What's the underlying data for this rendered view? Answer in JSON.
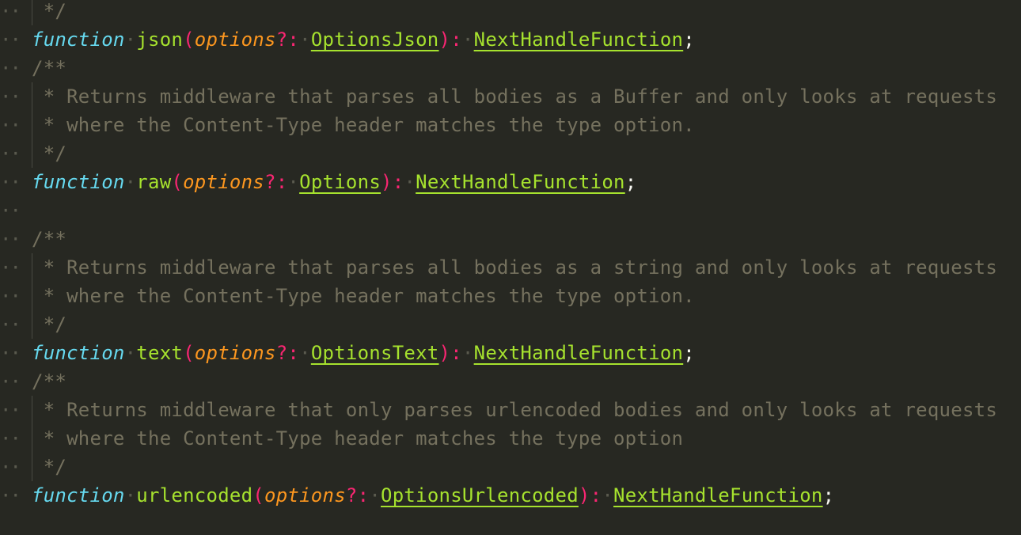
{
  "colors": {
    "background": "#272822",
    "keyword": "#66d9ef",
    "function_name": "#a6e22e",
    "parameter": "#fd971f",
    "operator": "#f92672",
    "type": "#a6e22e",
    "comment": "#75715e",
    "punctuation": "#f8f8f2"
  },
  "lines": [
    {
      "kind": "comment",
      "guide": true,
      "text": " */"
    },
    {
      "kind": "decl",
      "keyword": "function",
      "name": "json",
      "param": "options",
      "optional": "?",
      "colon": ":",
      "param_type": "OptionsJson",
      "ret_colon": ":",
      "ret_type": "NextHandleFunction",
      "end": ";"
    },
    {
      "kind": "comment",
      "guide": false,
      "text": "/**"
    },
    {
      "kind": "comment",
      "guide": true,
      "text": " * Returns middleware that parses all bodies as a Buffer and only looks at requests"
    },
    {
      "kind": "comment",
      "guide": true,
      "text": " * where the Content-Type header matches the type option."
    },
    {
      "kind": "comment",
      "guide": true,
      "text": " */"
    },
    {
      "kind": "decl",
      "keyword": "function",
      "name": "raw",
      "param": "options",
      "optional": "?",
      "colon": ":",
      "param_type": "Options",
      "ret_colon": ":",
      "ret_type": "NextHandleFunction",
      "end": ";"
    },
    {
      "kind": "blank"
    },
    {
      "kind": "comment",
      "guide": false,
      "text": "/**"
    },
    {
      "kind": "comment",
      "guide": true,
      "text": " * Returns middleware that parses all bodies as a string and only looks at requests"
    },
    {
      "kind": "comment",
      "guide": true,
      "text": " * where the Content-Type header matches the type option."
    },
    {
      "kind": "comment",
      "guide": true,
      "text": " */"
    },
    {
      "kind": "decl",
      "keyword": "function",
      "name": "text",
      "param": "options",
      "optional": "?",
      "colon": ":",
      "param_type": "OptionsText",
      "ret_colon": ":",
      "ret_type": "NextHandleFunction",
      "end": ";"
    },
    {
      "kind": "comment",
      "guide": false,
      "text": "/**"
    },
    {
      "kind": "comment",
      "guide": true,
      "text": " * Returns middleware that only parses urlencoded bodies and only looks at requests"
    },
    {
      "kind": "comment",
      "guide": true,
      "text": " * where the Content-Type header matches the type option"
    },
    {
      "kind": "comment",
      "guide": true,
      "text": " */"
    },
    {
      "kind": "decl",
      "keyword": "function",
      "name": "urlencoded",
      "param": "options",
      "optional": "?",
      "colon": ":",
      "param_type": "OptionsUrlencoded",
      "ret_colon": ":",
      "ret_type": "NextHandleFunction",
      "end": ";"
    }
  ],
  "whitespace_marker": "··",
  "open_paren": "(",
  "close_paren": ")"
}
